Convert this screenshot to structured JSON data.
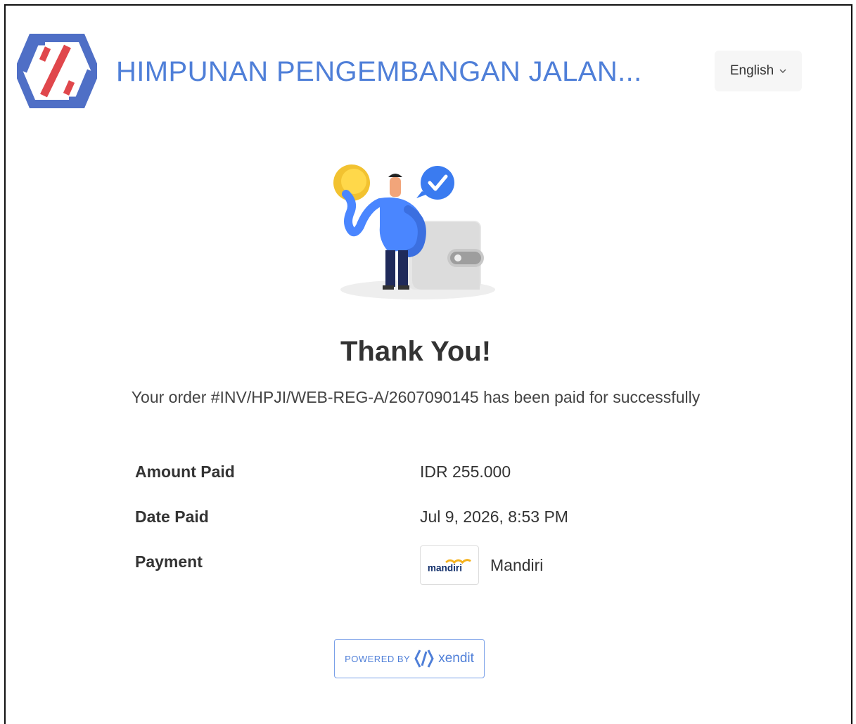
{
  "header": {
    "title": "HIMPUNAN PENGEMBANGAN JALAN...",
    "language": "English"
  },
  "main": {
    "heading": "Thank You!",
    "order_message": "Your order #INV/HPJI/WEB-REG-A/2607090145 has been paid for successfully"
  },
  "details": {
    "amount_label": "Amount Paid",
    "amount_value": "IDR 255.000",
    "date_label": "Date Paid",
    "date_value": "Jul 9, 2026, 8:53 PM",
    "payment_label": "Payment",
    "payment_logo_text": "mandiri",
    "payment_value": "Mandiri"
  },
  "footer": {
    "powered_by": "POWERED BY",
    "provider": "xendit"
  },
  "colors": {
    "brand_blue": "#4f7fd8",
    "brand_red": "#e0474c"
  },
  "icons": {
    "logo": "hpji-logo-icon",
    "language_chevron": "chevron-down-icon",
    "illustration": "payment-success-illustration",
    "bank": "mandiri-logo-icon",
    "xendit": "xendit-logo-icon"
  }
}
